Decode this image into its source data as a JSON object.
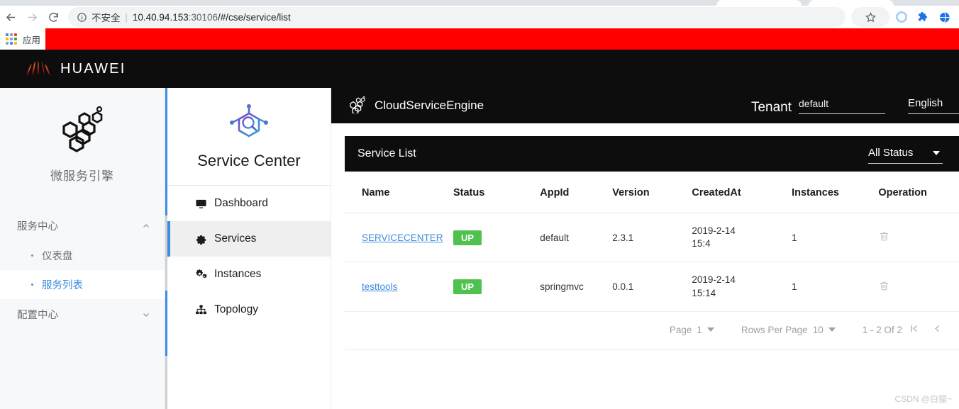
{
  "browser": {
    "back_icon": "back-arrow-icon",
    "forward_icon": "forward-arrow-icon",
    "reload_icon": "reload-icon",
    "info_icon": "info-circle-icon",
    "security_label": "不安全",
    "separator": "|",
    "url_host": "10.40.94.153",
    "url_port": ":30106",
    "url_path": "/#/cse/service/list",
    "star_icon": "bookmark-star-icon",
    "profile_icon": "profile-circle-icon",
    "extensions_icon": "puzzle-extensions-icon",
    "globe_icon": "globe-icon",
    "apps_label": "应用",
    "apps_icon": "apps-grid-icon",
    "banner_color": "#ff0000"
  },
  "huawei_bar": {
    "logo_icon": "huawei-flower-logo",
    "brand": "HUAWEI"
  },
  "left_sidebar": {
    "logo_icon": "hexagon-cluster-icon",
    "title": "微服务引擎",
    "groups": [
      {
        "label": "服务中心",
        "chevron": "chevron-up-icon",
        "items": [
          {
            "label": "仪表盘",
            "active": false
          },
          {
            "label": "服务列表",
            "active": true
          }
        ]
      },
      {
        "label": "配置中心",
        "chevron": "chevron-down-icon",
        "items": []
      }
    ],
    "active_color": "#3c8dde"
  },
  "service_nav": {
    "logo_icon": "hexagon-magnifier-icon",
    "title": "Service Center",
    "items": [
      {
        "label": "Dashboard",
        "icon": "monitor-icon",
        "active": false
      },
      {
        "label": "Services",
        "icon": "gear-icon",
        "active": true
      },
      {
        "label": "Instances",
        "icon": "cogs-icon",
        "active": false
      },
      {
        "label": "Topology",
        "icon": "sitemap-icon",
        "active": false
      }
    ]
  },
  "header": {
    "logo_icon": "hexagon-cluster-icon",
    "brand": "CloudServiceEngine",
    "tenant_label": "Tenant",
    "tenant_value": "default",
    "language_value": "English"
  },
  "service_list": {
    "title": "Service List",
    "status_filter": "All Status",
    "status_filter_caret": "chevron-down-icon",
    "search_icon": "search-icon",
    "columns": [
      "Name",
      "Status",
      "AppId",
      "Version",
      "CreatedAt",
      "Instances",
      "Operation"
    ],
    "rows": [
      {
        "name": "SERVICECENTER",
        "status": "UP",
        "app_id": "default",
        "version": "2.3.1",
        "created_date": "2019-2-14",
        "created_time": "15:4",
        "instances": "1",
        "operation_icon": "trash-icon"
      },
      {
        "name": "testtools",
        "status": "UP",
        "app_id": "springmvc",
        "version": "0.0.1",
        "created_date": "2019-2-14",
        "created_time": "15:14",
        "instances": "1",
        "operation_icon": "trash-icon"
      }
    ],
    "status_badge_color": "#4fc14f",
    "link_color": "#3c8dde"
  },
  "pagination": {
    "page_label": "Page",
    "page_value": "1",
    "rows_per_page_label": "Rows Per Page",
    "rows_per_page_value": "10",
    "range_text": "1 - 2 Of 2",
    "first_icon": "first-page-icon",
    "prev_icon": "previous-page-icon",
    "next_icon": "next-page-icon"
  },
  "watermark": {
    "text": "CSDN @白猫~"
  }
}
